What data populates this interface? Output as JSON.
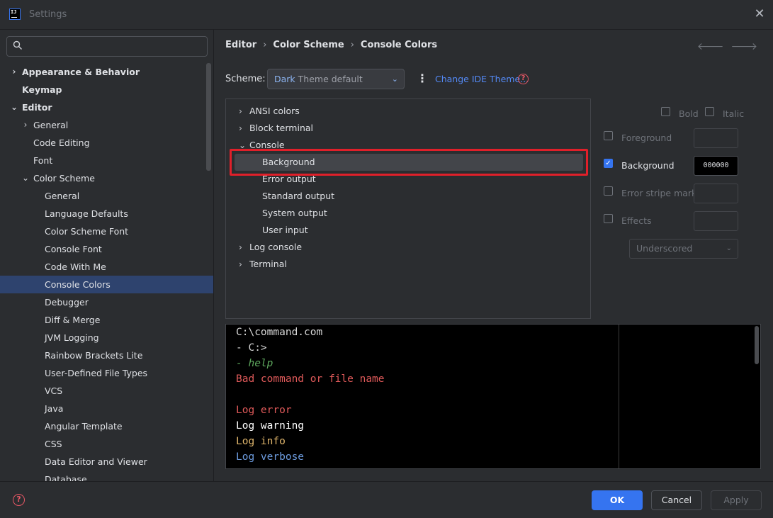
{
  "window": {
    "title": "Settings",
    "close_glyph": "✕"
  },
  "app_icon": {
    "text": "IJ"
  },
  "sidebar": {
    "search_placeholder": "",
    "items": [
      {
        "label": "Appearance & Behavior",
        "level": 0,
        "chevron": "›",
        "bold": true
      },
      {
        "label": "Keymap",
        "level": 0,
        "chevron": "",
        "bold": true
      },
      {
        "label": "Editor",
        "level": 0,
        "chevron": "⌄",
        "bold": true
      },
      {
        "label": "General",
        "level": 1,
        "chevron": "›"
      },
      {
        "label": "Code Editing",
        "level": 1,
        "chevron": ""
      },
      {
        "label": "Font",
        "level": 1,
        "chevron": ""
      },
      {
        "label": "Color Scheme",
        "level": 1,
        "chevron": "⌄"
      },
      {
        "label": "General",
        "level": 2,
        "chevron": ""
      },
      {
        "label": "Language Defaults",
        "level": 2,
        "chevron": ""
      },
      {
        "label": "Color Scheme Font",
        "level": 2,
        "chevron": ""
      },
      {
        "label": "Console Font",
        "level": 2,
        "chevron": ""
      },
      {
        "label": "Code With Me",
        "level": 2,
        "chevron": ""
      },
      {
        "label": "Console Colors",
        "level": 2,
        "chevron": "",
        "selected": true
      },
      {
        "label": "Debugger",
        "level": 2,
        "chevron": ""
      },
      {
        "label": "Diff & Merge",
        "level": 2,
        "chevron": ""
      },
      {
        "label": "JVM Logging",
        "level": 2,
        "chevron": ""
      },
      {
        "label": "Rainbow Brackets Lite",
        "level": 2,
        "chevron": ""
      },
      {
        "label": "User-Defined File Types",
        "level": 2,
        "chevron": ""
      },
      {
        "label": "VCS",
        "level": 2,
        "chevron": ""
      },
      {
        "label": "Java",
        "level": 2,
        "chevron": ""
      },
      {
        "label": "Angular Template",
        "level": 2,
        "chevron": ""
      },
      {
        "label": "CSS",
        "level": 2,
        "chevron": ""
      },
      {
        "label": "Data Editor and Viewer",
        "level": 2,
        "chevron": ""
      },
      {
        "label": "Database",
        "level": 2,
        "chevron": ""
      }
    ]
  },
  "breadcrumb": {
    "items": [
      "Editor",
      "Color Scheme",
      "Console Colors"
    ],
    "separator": "›"
  },
  "nav": {
    "back": "🡐",
    "forward": "🡒"
  },
  "scheme": {
    "label": "Scheme:",
    "value_name": "Dark",
    "value_rest": " Theme default",
    "caret": "⌄",
    "more_glyph": "⋮",
    "change_link": "Change IDE Theme...",
    "help_glyph": "?"
  },
  "options": [
    {
      "label": "ANSI colors",
      "chevron": "›",
      "level": 0
    },
    {
      "label": "Block terminal",
      "chevron": "›",
      "level": 0
    },
    {
      "label": "Console",
      "chevron": "⌄",
      "level": 0
    },
    {
      "label": "Background",
      "chevron": "",
      "level": 1,
      "selected": true
    },
    {
      "label": "Error output",
      "chevron": "",
      "level": 1
    },
    {
      "label": "Standard output",
      "chevron": "",
      "level": 1
    },
    {
      "label": "System output",
      "chevron": "",
      "level": 1
    },
    {
      "label": "User input",
      "chevron": "",
      "level": 1
    },
    {
      "label": "Log console",
      "chevron": "›",
      "level": 0
    },
    {
      "label": "Terminal",
      "chevron": "›",
      "level": 0
    }
  ],
  "attributes": {
    "bold": {
      "label": "Bold",
      "checked": false
    },
    "italic": {
      "label": "Italic",
      "checked": false
    },
    "foreground": {
      "label": "Foreground",
      "checked": false,
      "value": ""
    },
    "background": {
      "label": "Background",
      "checked": true,
      "value": "000000"
    },
    "error_stripe": {
      "label": "Error stripe mark",
      "checked": false,
      "value": ""
    },
    "effects": {
      "label": "Effects",
      "checked": false,
      "value": ""
    },
    "effect_type": "Underscored",
    "check_glyph": "✓",
    "caret": "⌄"
  },
  "preview": {
    "lines": [
      {
        "text": "C:\\command.com",
        "color": "#d7d7d7",
        "italic": false
      },
      {
        "text": "- C:>",
        "color": "#d7d7d7",
        "italic": false
      },
      {
        "text": "- help",
        "color": "#5fa95f",
        "italic": true
      },
      {
        "text": "Bad command or file name",
        "color": "#e05a5a",
        "italic": false
      },
      {
        "text": "",
        "color": "#d7d7d7",
        "italic": false
      },
      {
        "text": "Log error",
        "color": "#e05a5a",
        "italic": false
      },
      {
        "text": "Log warning",
        "color": "#ffffff",
        "italic": false
      },
      {
        "text": "Log info",
        "color": "#e0b66c",
        "italic": false
      },
      {
        "text": "Log verbose",
        "color": "#6d9cdf",
        "italic": false
      }
    ]
  },
  "footer": {
    "help_glyph": "?",
    "ok": "OK",
    "cancel": "Cancel",
    "apply": "Apply"
  }
}
